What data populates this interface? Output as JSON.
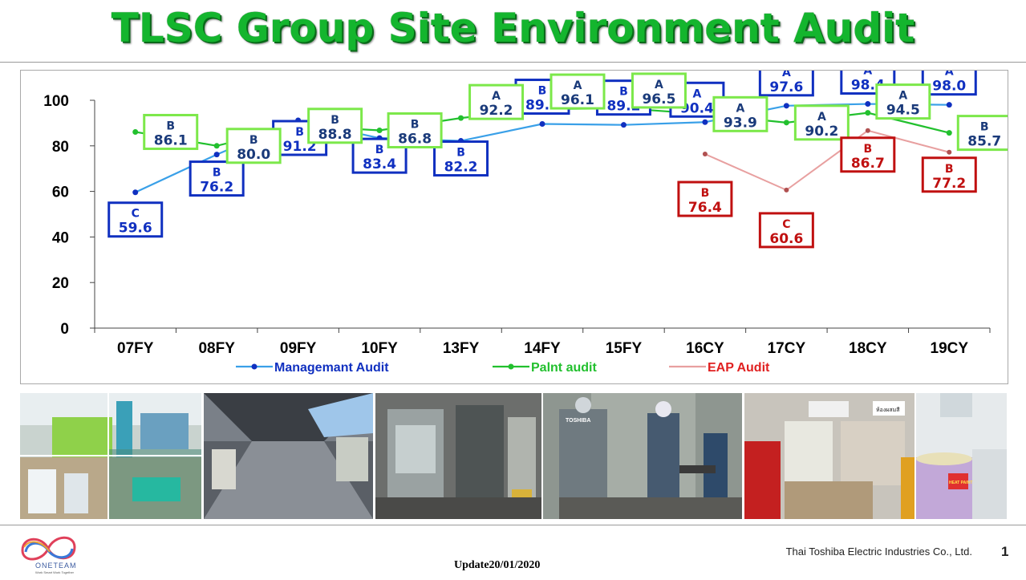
{
  "title": "TLSC Group Site Environment Audit",
  "footer": {
    "company": "Thai Toshiba Electric Industries Co., Ltd.",
    "page_number": "1",
    "update": "Update20/01/2020",
    "logo_text": "ONETEAM",
    "logo_tagline": "Work Smart Work Together"
  },
  "photo_labels": {
    "machine_brand": "TOSHIBA",
    "drum_label": "HEAT PAINT",
    "sign_text": "ห้องผสมสี"
  },
  "colors": {
    "title_green": "#14b52e",
    "management_blue": "#1030c0",
    "paint_green": "#22c02e",
    "eap_red": "#c01010",
    "eap_line": "#e8a0a0"
  },
  "chart_data": {
    "type": "line",
    "categories": [
      "07FY",
      "08FY",
      "09FY",
      "10FY",
      "13FY",
      "14FY",
      "15FY",
      "16CY",
      "17CY",
      "18CY",
      "19CY"
    ],
    "ylim": [
      0,
      100
    ],
    "yticks": [
      "0",
      "20",
      "40",
      "60",
      "80",
      "100"
    ],
    "legend_position": "bottom",
    "grid": false,
    "series": [
      {
        "name": "Managemant Audit",
        "values": [
          59.6,
          76.2,
          91.2,
          83.4,
          82.2,
          89.6,
          89.2,
          90.4,
          97.6,
          98.4,
          98.0
        ],
        "value_labels": [
          "59.6",
          "76.2",
          "91.2",
          "83.4",
          "82.2",
          "89.6",
          "89.2",
          "90.4",
          "97.6",
          "98.4",
          "98.0"
        ],
        "grades": [
          "C",
          "B",
          "B",
          "B",
          "B",
          "B",
          "B",
          "A",
          "A",
          "A",
          "A"
        ]
      },
      {
        "name": "Palnt audit",
        "values": [
          86.1,
          80.0,
          88.8,
          86.8,
          92.2,
          96.1,
          96.5,
          93.9,
          90.2,
          94.5,
          85.7
        ],
        "value_labels": [
          "86.1",
          "80.0",
          "88.8",
          "86.8",
          "92.2",
          "96.1",
          "96.5",
          "93.9",
          "90.2",
          "94.5",
          "85.7"
        ],
        "grades": [
          "B",
          "B",
          "B",
          "B",
          "A",
          "A",
          "A",
          "A",
          "A",
          "A",
          "B"
        ]
      },
      {
        "name": "EAP Audit",
        "values": [
          null,
          null,
          null,
          null,
          null,
          null,
          null,
          76.4,
          60.6,
          86.7,
          77.2
        ],
        "value_labels": [
          null,
          null,
          null,
          null,
          null,
          null,
          null,
          "76.4",
          "60.6",
          "86.7",
          "77.2"
        ],
        "grades": [
          null,
          null,
          null,
          null,
          null,
          null,
          null,
          "B",
          "C",
          "B",
          "B"
        ]
      }
    ]
  }
}
